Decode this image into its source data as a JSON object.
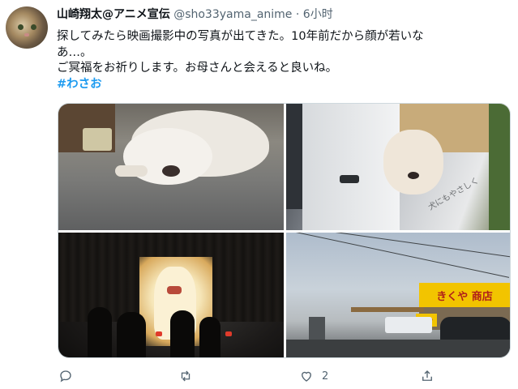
{
  "tweet": {
    "author_name": "山崎翔太@アニメ宣伝",
    "handle": "@sho33yama_anime",
    "separator": "·",
    "time": "6小时",
    "lines": [
      "探してみたら映画撮影中の写真が出てきた。10年前だから顔が若いな",
      "あ…。",
      "ご冥福をお祈りします。お母さんと会えると良いね。"
    ],
    "hashtag": "#わさお"
  },
  "photos": {
    "top_right_truck_text": "犬にもやさしく",
    "bottom_right_sign": "きくや 商店",
    "bottom_right_sign_small": "くや"
  },
  "actions": {
    "reply_icon": "reply-icon",
    "retweet_icon": "retweet-icon",
    "like_icon": "like-icon",
    "like_count": "2",
    "share_icon": "share-icon"
  },
  "colors": {
    "link": "#1d9bf0",
    "secondary_text": "#536471",
    "sign_yellow": "#f2c400"
  }
}
